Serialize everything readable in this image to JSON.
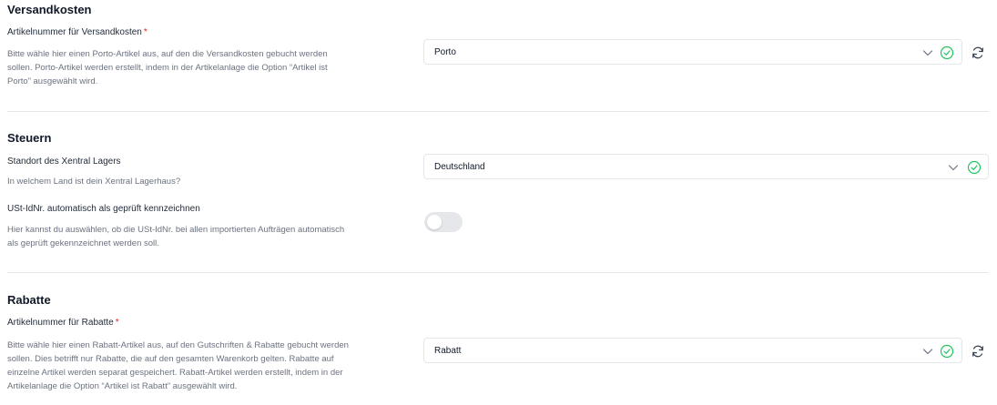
{
  "colors": {
    "accent_success": "#22c55e",
    "required": "#dc2626",
    "divider": "#e5e7eb",
    "toggle_off": "#e5e7eb"
  },
  "versand": {
    "title": "Versandkosten",
    "field_label": "Artikelnummer für Versandkosten",
    "required_mark": "*",
    "desc": [
      "Bitte wähle hier einen Porto-Artikel aus, auf den die Versandkosten gebucht werden",
      "sollen. Porto-Artikel werden erstellt, indem in der Artikelanlage die Option “Artikel ist",
      "Porto” ausgewählt wird."
    ],
    "select_value": "Porto",
    "icons": {
      "chevron": "chevron-down-icon",
      "valid": "check-circle-icon",
      "refresh": "refresh-icon"
    }
  },
  "steuern": {
    "title": "Steuern",
    "lager_label": "Standort des Xentral Lagers",
    "lager_desc": "In welchem Land ist dein Xentral Lagerhaus?",
    "lager_value": "Deutschland",
    "ust_label": "USt-IdNr. automatisch als geprüft kennzeichnen",
    "ust_desc": [
      "Hier kannst du auswählen, ob die USt-IdNr. bei allen importierten Aufträgen automatisch",
      "als geprüft gekennzeichnet werden soll."
    ],
    "ust_enabled": false
  },
  "rabatte": {
    "title": "Rabatte",
    "field_label": "Artikelnummer für Rabatte",
    "required_mark": "*",
    "desc": [
      "Bitte wähle hier einen Rabatt-Artikel aus, auf den Gutschriften & Rabatte gebucht werden",
      "sollen. Dies betrifft nur Rabatte, die auf den gesamten Warenkorb gelten. Rabatte auf",
      "einzelne Artikel werden separat gespeichert. Rabatt-Artikel werden erstellt, indem in der",
      "Artikelanlage die Option “Artikel ist Rabatt” ausgewählt wird."
    ],
    "select_value": "Rabatt"
  }
}
